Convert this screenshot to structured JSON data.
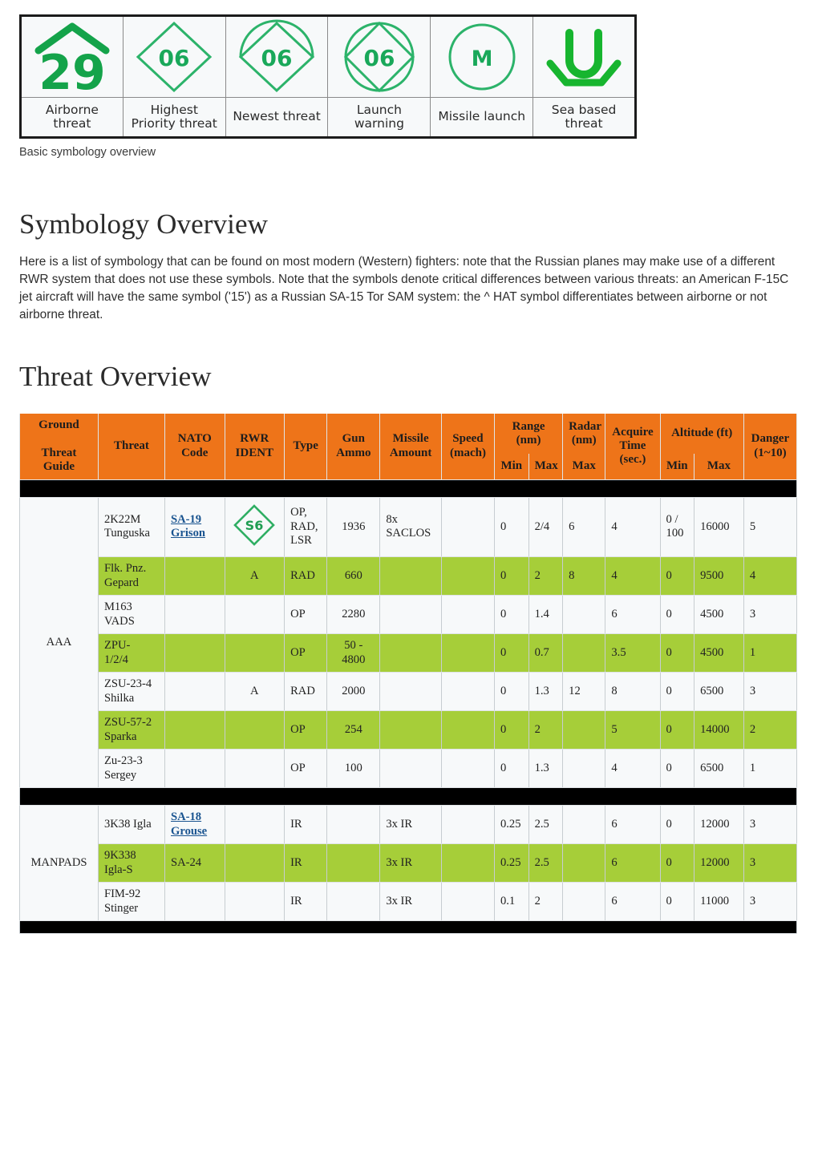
{
  "symbology": {
    "caption": "Basic symbology overview",
    "accent_green": "#18a957",
    "cells": [
      {
        "icon": "airborne-threat-hat-symbol",
        "value": "29",
        "label": "Airborne\nthreat"
      },
      {
        "icon": "highest-priority-diamond-symbol",
        "value": "06",
        "label": "Highest\nPriority threat"
      },
      {
        "icon": "newest-threat-arc-diamond-symbol",
        "value": "06",
        "label": "Newest threat"
      },
      {
        "icon": "launch-warning-circle-diamond-symbol",
        "value": "06",
        "label": "Launch\nwarning"
      },
      {
        "icon": "missile-launch-circle-symbol",
        "value": "M",
        "label": "Missile launch"
      },
      {
        "icon": "sea-based-threat-u-symbol",
        "value": "U",
        "label": "Sea based\nthreat"
      }
    ]
  },
  "symbology_section": {
    "title": "Symbology Overview",
    "paragraph": "Here is a list of symbology that can be found on most modern (Western) fighters: note that the Russian planes may make use of a different RWR system that does not use these symbols. Note that the symbols denote critical differences between various threats: an American F-15C jet aircraft will have the same symbol ('15') as a Russian SA-15 Tor SAM system: the ^ HAT symbol differentiates between airborne or not airborne threat."
  },
  "threat_section": {
    "title": "Threat Overview",
    "colors": {
      "header_bg": "#ee7419",
      "alt_row_bg": "#a6ce39",
      "row_bg": "#f7f9fa",
      "link": "#1a5490"
    },
    "headers": {
      "group": "Ground\n\nThreat\nGuide",
      "threat": "Threat",
      "nato_code": "NATO\nCode",
      "rwr_ident": "RWR\nIDENT",
      "type": "Type",
      "gun_ammo": "Gun\nAmmo",
      "missile_amount": "Missile\nAmount",
      "speed": "Speed\n(mach)",
      "range": "Range\n(nm)",
      "range_min": "Min",
      "range_max": "Max",
      "radar": "Radar\n(nm)",
      "radar_max": "Max",
      "acquire_time": "Acquire\nTime\n(sec.)",
      "altitude": "Altitude (ft)",
      "altitude_min": "Min",
      "altitude_max": "Max",
      "danger": "Danger\n(1~10)"
    },
    "groups": [
      {
        "name": "AAA",
        "rows": [
          {
            "threat": "2K22M\nTunguska",
            "nato_code": "SA-19\nGrison",
            "nato_is_link": true,
            "rwr_ident": "S6",
            "rwr_shape": "diamond",
            "type": "OP,\nRAD,\nLSR",
            "gun_ammo": "1936",
            "missile_amount": "8x\nSACLOS",
            "speed": "",
            "range_min": "0",
            "range_max": "2/4",
            "radar_max": "6",
            "acquire_time": "4",
            "altitude_min": "0 /\n100",
            "altitude_max": "16000",
            "danger": "5"
          },
          {
            "threat": "Flk. Pnz.\nGepard",
            "nato_code": "",
            "nato_is_link": false,
            "rwr_ident": "A",
            "rwr_shape": "text",
            "type": "RAD",
            "gun_ammo": "660",
            "missile_amount": "",
            "speed": "",
            "range_min": "0",
            "range_max": "2",
            "radar_max": "8",
            "acquire_time": "4",
            "altitude_min": "0",
            "altitude_max": "9500",
            "danger": "4"
          },
          {
            "threat": "M163\nVADS",
            "nato_code": "",
            "nato_is_link": false,
            "rwr_ident": "",
            "rwr_shape": "text",
            "type": "OP",
            "gun_ammo": "2280",
            "missile_amount": "",
            "speed": "",
            "range_min": "0",
            "range_max": "1.4",
            "radar_max": "",
            "acquire_time": "6",
            "altitude_min": "0",
            "altitude_max": "4500",
            "danger": "3"
          },
          {
            "threat": "ZPU-\n1/2/4",
            "nato_code": "",
            "nato_is_link": false,
            "rwr_ident": "",
            "rwr_shape": "text",
            "type": "OP",
            "gun_ammo": "50 -\n4800",
            "missile_amount": "",
            "speed": "",
            "range_min": "0",
            "range_max": "0.7",
            "radar_max": "",
            "acquire_time": "3.5",
            "altitude_min": "0",
            "altitude_max": "4500",
            "danger": "1"
          },
          {
            "threat": "ZSU-23-4\nShilka",
            "nato_code": "",
            "nato_is_link": false,
            "rwr_ident": "A",
            "rwr_shape": "text",
            "type": "RAD",
            "gun_ammo": "2000",
            "missile_amount": "",
            "speed": "",
            "range_min": "0",
            "range_max": "1.3",
            "radar_max": "12",
            "acquire_time": "8",
            "altitude_min": "0",
            "altitude_max": "6500",
            "danger": "3"
          },
          {
            "threat": "ZSU-57-2\nSparka",
            "nato_code": "",
            "nato_is_link": false,
            "rwr_ident": "",
            "rwr_shape": "text",
            "type": "OP",
            "gun_ammo": "254",
            "missile_amount": "",
            "speed": "",
            "range_min": "0",
            "range_max": "2",
            "radar_max": "",
            "acquire_time": "5",
            "altitude_min": "0",
            "altitude_max": "14000",
            "danger": "2"
          },
          {
            "threat": "Zu-23-3\nSergey",
            "nato_code": "",
            "nato_is_link": false,
            "rwr_ident": "",
            "rwr_shape": "text",
            "type": "OP",
            "gun_ammo": "100",
            "missile_amount": "",
            "speed": "",
            "range_min": "0",
            "range_max": "1.3",
            "radar_max": "",
            "acquire_time": "4",
            "altitude_min": "0",
            "altitude_max": "6500",
            "danger": "1"
          }
        ]
      },
      {
        "name": "MANPADS",
        "rows": [
          {
            "threat": "3K38 Igla",
            "nato_code": "SA-18\nGrouse",
            "nato_is_link": true,
            "rwr_ident": "",
            "rwr_shape": "text",
            "type": "IR",
            "gun_ammo": "",
            "missile_amount": "3x IR",
            "speed": "",
            "range_min": "0.25",
            "range_max": "2.5",
            "radar_max": "",
            "acquire_time": "6",
            "altitude_min": "0",
            "altitude_max": "12000",
            "danger": "3"
          },
          {
            "threat": "9K338\nIgla-S",
            "nato_code": "SA-24",
            "nato_is_link": false,
            "rwr_ident": "",
            "rwr_shape": "text",
            "type": "IR",
            "gun_ammo": "",
            "missile_amount": "3x IR",
            "speed": "",
            "range_min": "0.25",
            "range_max": "2.5",
            "radar_max": "",
            "acquire_time": "6",
            "altitude_min": "0",
            "altitude_max": "12000",
            "danger": "3"
          },
          {
            "threat": "FIM-92\nStinger",
            "nato_code": "",
            "nato_is_link": false,
            "rwr_ident": "",
            "rwr_shape": "text",
            "type": "IR",
            "gun_ammo": "",
            "missile_amount": "3x IR",
            "speed": "",
            "range_min": "0.1",
            "range_max": "2",
            "radar_max": "",
            "acquire_time": "6",
            "altitude_min": "0",
            "altitude_max": "11000",
            "danger": "3"
          }
        ]
      }
    ]
  }
}
